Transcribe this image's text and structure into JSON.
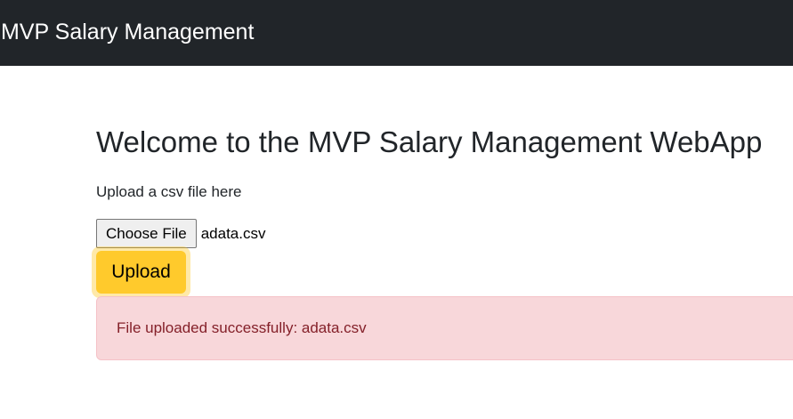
{
  "navbar": {
    "brand": "MVP Salary Management"
  },
  "main": {
    "title": "Welcome to the MVP Salary Management WebApp",
    "upload_label": "Upload a csv file here",
    "file_input": {
      "button_label": "Choose File",
      "selected_file": "adata.csv"
    },
    "upload_button_label": "Upload",
    "alert": {
      "message": "File uploaded successfully: adata.csv",
      "colors": {
        "background": "#f8d7da",
        "text": "#842029"
      }
    }
  },
  "colors": {
    "navbar_bg": "#212529",
    "upload_button": "#ffca2c"
  }
}
